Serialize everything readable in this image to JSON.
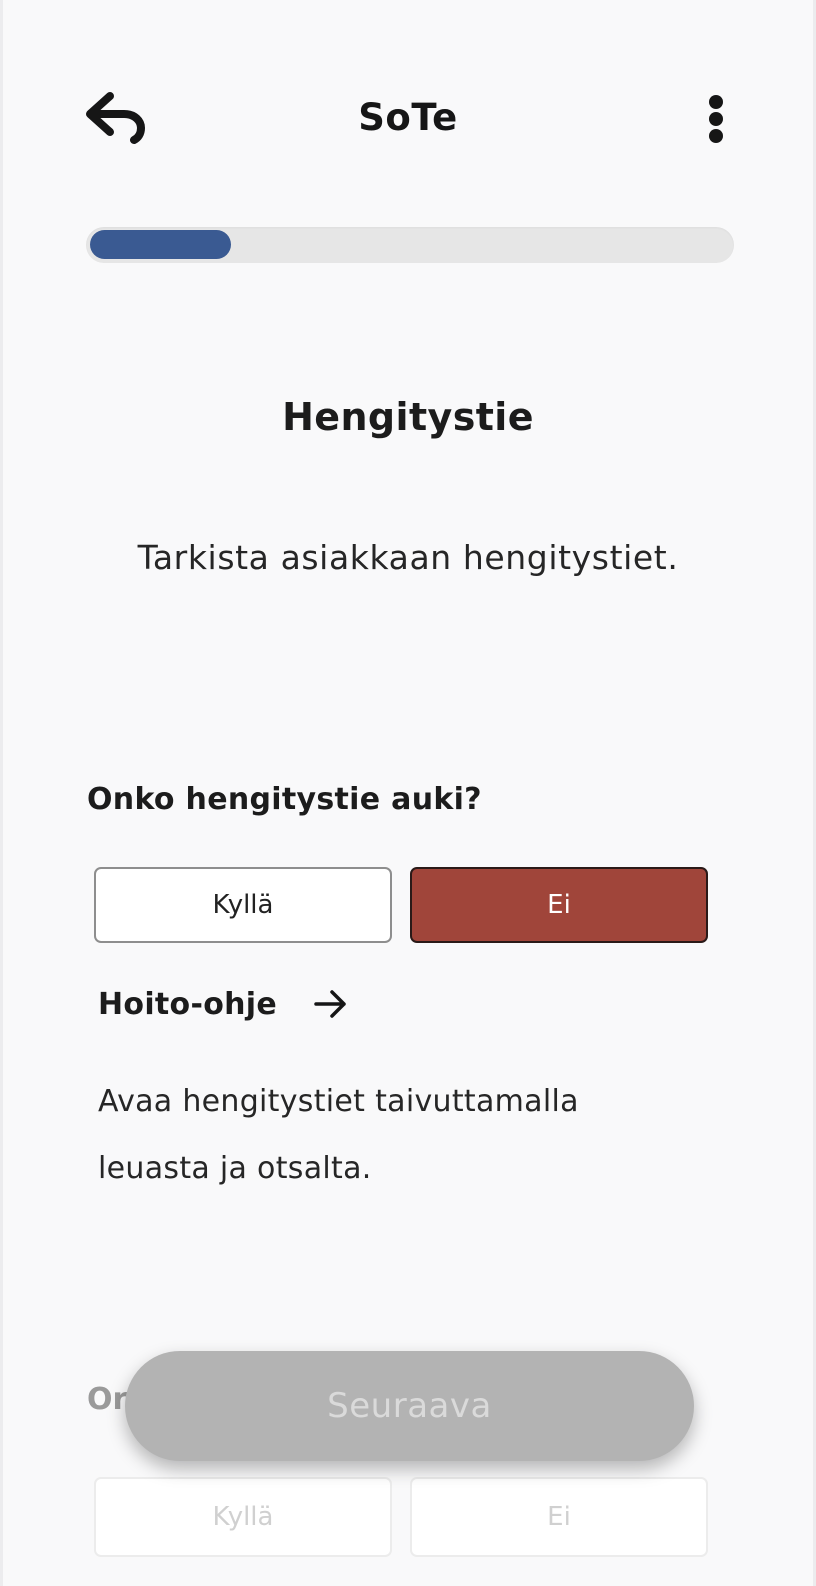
{
  "header": {
    "title": "SoTe",
    "back_icon": "back-arrow-icon",
    "menu_icon": "more-vertical-icon"
  },
  "progress": {
    "fraction": 0.22
  },
  "step": {
    "title": "Hengitystie",
    "description": "Tarkista asiakkaan hengitystiet."
  },
  "question": {
    "label": "Onko hengitystie auki?",
    "yes_label": "Kyllä",
    "no_label": "Ei",
    "selected": "Ei"
  },
  "care": {
    "link_label": "Hoito-ohje",
    "link_icon": "arrow-right-icon",
    "text": "Avaa hengitystiet taivuttamalla leuasta ja otsalta."
  },
  "next_question": {
    "label_visible": "Or",
    "yes_label": "Kyllä",
    "no_label": "Ei"
  },
  "footer": {
    "next_label": "Seuraava"
  },
  "colors": {
    "progress": "#3a5a92",
    "selected_answer": "#a0453a",
    "next_disabled": "#b3b3b3"
  }
}
